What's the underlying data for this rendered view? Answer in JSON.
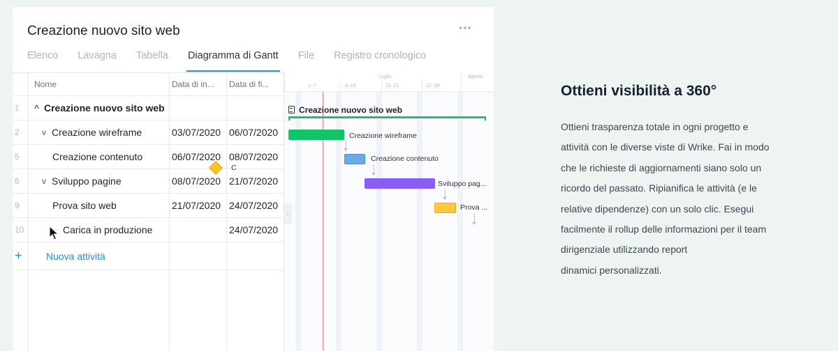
{
  "project": {
    "title": "Creazione nuovo sito web",
    "more_label": "•••"
  },
  "tabs": [
    {
      "label": "Elenco",
      "active": false
    },
    {
      "label": "Lavagna",
      "active": false
    },
    {
      "label": "Tabella",
      "active": false
    },
    {
      "label": "Diagramma di Gantt",
      "active": true
    },
    {
      "label": "File",
      "active": false
    },
    {
      "label": "Registro cronologico",
      "active": false
    }
  ],
  "table": {
    "headers": {
      "name": "Nome",
      "start": "Data di in...",
      "end": "Data di fi..."
    },
    "rows": [
      {
        "num": "1",
        "name": "Creazione nuovo sito web",
        "start": "",
        "end": "",
        "chevron": "^"
      },
      {
        "num": "2",
        "name": "Creazione wireframe",
        "start": "03/07/2020",
        "end": "06/07/2020",
        "chevron": "v"
      },
      {
        "num": "5",
        "name": "Creazione contenuto",
        "start": "06/07/2020",
        "end": "08/07/2020",
        "chevron": ""
      },
      {
        "num": "6",
        "name": "Sviluppo pagine",
        "start": "08/07/2020",
        "end": "21/07/2020",
        "chevron": "v"
      },
      {
        "num": "9",
        "name": "Prova sito web",
        "start": "21/07/2020",
        "end": "24/07/2020",
        "chevron": ""
      },
      {
        "num": "10",
        "name": "Carica in produzione",
        "start": "",
        "end": "24/07/2020",
        "chevron": ""
      }
    ],
    "add": {
      "icon": "+",
      "label": "Nuova attività"
    }
  },
  "gantt": {
    "months": [
      "Luglio",
      "Agosto"
    ],
    "weeks": [
      "1–7",
      "8–14",
      "15–21",
      "22–28"
    ],
    "project_label": "Creazione nuovo sito web",
    "task_labels": [
      "Creazione wireframe",
      "Creazione contenuto",
      "Sviluppo pag...",
      "Prova ...",
      "C"
    ],
    "handle_icon": "‹"
  },
  "colors": {
    "accent": "#2a8ae0",
    "project_bar": "#22bf64",
    "wireframe_bar": "#12c469",
    "contenuto_bar": "#6aabea",
    "sviluppo_bar": "#8b5cf6",
    "prova_bar": "#fcc93e",
    "milestone": "#f8c52c",
    "today_line": "#f07c8c"
  },
  "panel": {
    "title": "Ottieni visibilità a 360°",
    "lines": [
      "Ottieni trasparenza totale in ogni progetto e",
      "attività con le diverse viste di Wrike. Fai in modo",
      "che le richieste di aggiornamenti siano solo un",
      "ricordo del passato. Ripianifica le attività (e le",
      "relative dipendenze) con un solo clic. Esegui",
      "facilmente il rollup delle informazioni per il team",
      "dirigenziale utilizzando report",
      "dinamici personalizzati."
    ]
  }
}
